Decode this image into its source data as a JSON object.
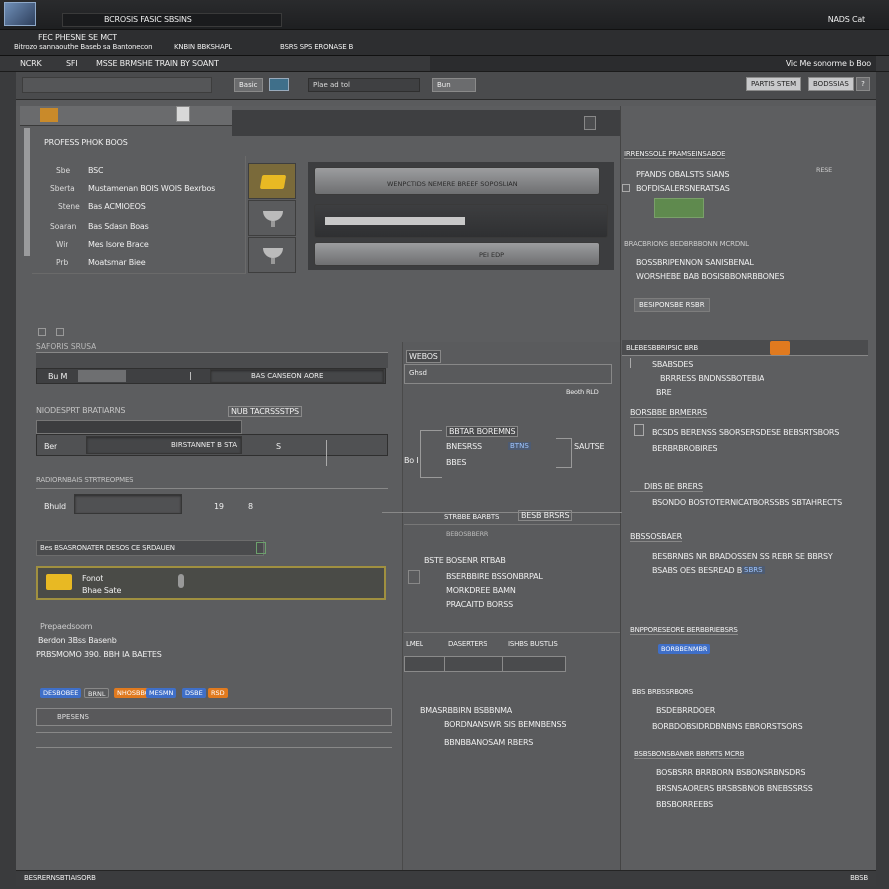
{
  "window": {
    "title": "BCROSIS FASIC SBSINS",
    "title_right": "NADS Cat",
    "menu_top": "FEC PHESNE SE MCT",
    "menu_items": [
      "Bitrozo sannaouthe Baseb sa Bantonecon",
      "KNBIN BBKSHAPL",
      "BSRS SPS ERONASE B"
    ],
    "toolbar_left": "NCRK",
    "toolbar_item_1": "SFI",
    "toolbar_item_2": "MSSE BRMSHE TRAIN BY SOANT",
    "toolbar_right": "Vic Me sonorme b Boo"
  },
  "navbar": {
    "btn_1": "Basic",
    "field_1": "Plae ad tol",
    "field_2": "Bun",
    "btn_right_1": "PARTIS STEM",
    "btn_right_2": "BODSSIAS",
    "help": "?"
  },
  "profile": {
    "header": "PROFESS PHOK BOOS",
    "rows": [
      {
        "label": "Sbe",
        "value": "BSC"
      },
      {
        "label": "Sberta",
        "value": "Mustamenan BOIS WOIS Bexrbos"
      },
      {
        "label": "Stene",
        "value": "Bas ACMIOEOS"
      },
      {
        "label": "Soaran",
        "value": "Bas Sdasn Boas"
      },
      {
        "label": "Wir",
        "value": "Mes Isore Brace"
      },
      {
        "label": "Prb",
        "value": "Moatsmar Biee"
      }
    ],
    "bar_1_text": "WENPCTIDS NEMERE BREEF SOPOSLIAN",
    "bar_3_text": "PEI EDP"
  },
  "left_form": {
    "section_1_label": "SAFORIS SRUSA",
    "field_1_label": "Bu M",
    "field_1_value": "BAS CANSEON AORE",
    "section_2_label": "NIODESPRT BRATIARNS",
    "section_2_tag": "NUB TACRSSSTPS",
    "field_2_label": "Ber",
    "field_2_value": "BIRSTANNET B STA",
    "field_2_end": "S",
    "section_3_label": "RADIORNBAIS STRTREOPMES",
    "field_3_label": "Bhuld",
    "field_3_num_1": "19",
    "field_3_num_2": "8",
    "select_label": "Bes BSASRONATER DESOS CE SRDAUEN",
    "item_title": "Fonot",
    "item_sub": "Bhae Sate",
    "notes_title": "Prepaedsoom",
    "notes_line_1": "Berdon 3Bss Basenb",
    "notes_line_2": "PRBSMOMO 390. BBH IA BAETES",
    "chips": [
      "DESBOBEE",
      "BRNL",
      "NHOSBBOR",
      "MESMN",
      "DSBE",
      "RSD"
    ],
    "footer_field": "BPESENS"
  },
  "mid": {
    "header_1": "WEBOS",
    "header_2": "Ghsd",
    "header_3": "Beoth RLD",
    "tree_1": "BBTAR BOREMNS",
    "tree_2": "BNESRSS",
    "tree_3": "BTNS",
    "tree_4": "BBES",
    "tree_5": "SAUTSE",
    "tree_left": "Bo I",
    "tree_foot_1": "STRBBE BARBTS",
    "tree_foot_2": "BESB BRSRS",
    "block_head": "BEBOSBBERR",
    "block_1": "BSTE BOSENR RTBAB",
    "block_2": "BSERBBIRE BSSONBRPAL",
    "block_3": "MORKDREE BAMN",
    "block_4": "PRACAITD BORSS",
    "tab_1": "LMEL",
    "tab_2": "DASERTERS",
    "tab_3": "ISHBS",
    "tab_4": "BUSTLIS",
    "list_1": "BMASRBBIRN BSBBNMA",
    "list_2": "BORDNANSWR SIS BEMNBENSS",
    "list_3": "BBNBBANOSAM RBERS"
  },
  "right": {
    "sec_1": "IRRENSSOLE PRAMSEINSABOE",
    "sec_1_r": "RESE",
    "sec_1_a": "PFANDS OBALSTS SIANS",
    "sec_1_b": "BOFDISALERSNERATSAS",
    "sec_2": "BRACBRIONS BEDBRBBONN MCRDNL",
    "sec_2_a": "BOSSBRIPENNON SANISBENAL",
    "sec_2_b": "WORSHEBE BAB BOSISBBONRBBONES",
    "sec_2_btn": "BESIPONSBE RSBR",
    "sec_3": "BLEBESBBRIPSIC BRB",
    "sec_3_a": "SBABSDES",
    "sec_3_b": "BRRRESS BNDNSSBOTEBIA",
    "sec_3_c": "BRE",
    "sec_4": "BORSBBE BRMERRS",
    "sec_4_a": "BCSDS BERENSS SBORSERSDESE BEBSRTSBORS",
    "sec_4_b": "BERBRBROBIRES",
    "sec_5": "DIBS BE BRERS",
    "sec_5_a": "BSONDO BOSTOTERNICATBORSSBS SBTAHRECTS",
    "sec_6": "BBSSOSBAER",
    "sec_6_a": "BESBRNBS NR BRADOSSEN SS REBR SE BBRSY",
    "sec_6_b": "BSABS OES BESREAD BREP",
    "sec_6_c": "SBRS",
    "sec_7": "BNPPORESEORE BERBBRIEBSRS",
    "sec_7_a": "BORBBENMBR",
    "sec_8": "BBS BRBSSRBORS",
    "sec_8_a": "BSDEBRRDOER",
    "sec_8_b": "BORBDOBSIDRDBNBNS  EBRORSTSORS",
    "sec_9": "BSBSBONSBANBR BBRRTS MCRB",
    "sec_9_a": "BOSBSRR BRRBORN BSBONSRBNSDRS",
    "sec_9_b": "BRSNSAORERS  BRSBSBNOB BNEBSSRSS",
    "sec_9_c": "BBSBORREEBS"
  },
  "status": {
    "left": "BESRERNSBTIAISORB",
    "right": "BBSB"
  },
  "colors": {
    "accent_yellow": "#e8b923",
    "accent_orange": "#e07a1f",
    "accent_green": "#5f8a4e",
    "accent_blue": "#3f6fc8"
  }
}
